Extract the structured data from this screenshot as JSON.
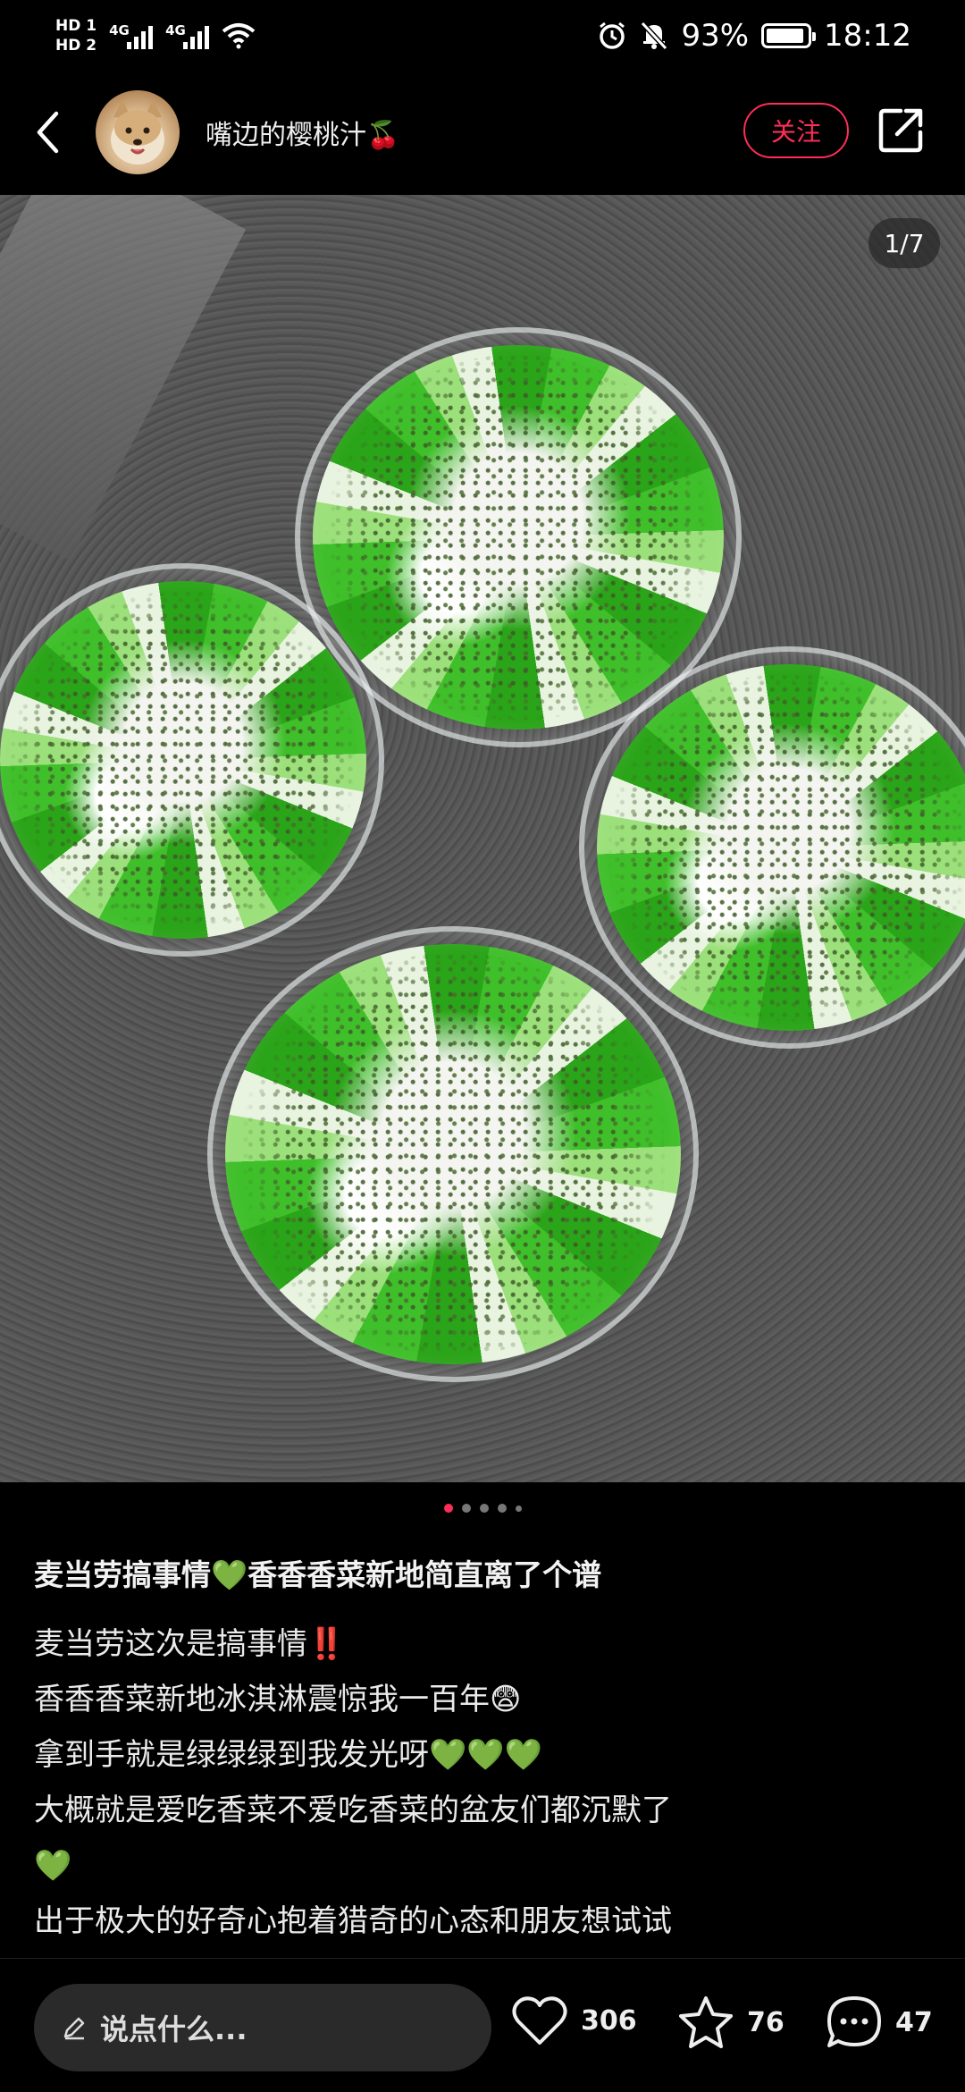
{
  "status_bar": {
    "sim1_label": "HD 1",
    "sim2_label": "HD 2",
    "network1": "4G",
    "network2": "4G",
    "battery_percent": "93%",
    "battery_level": 0.93,
    "time": "18:12",
    "icons": [
      "alarm-icon",
      "mute-icon",
      "wifi-icon",
      "battery-icon"
    ]
  },
  "header": {
    "username": "嘴边的樱桃汁🍒",
    "follow_label": "关注",
    "icons": [
      "back-icon",
      "share-icon"
    ]
  },
  "gallery": {
    "counter": "1/7",
    "current_index": 1,
    "total": 7
  },
  "post": {
    "title": "麦当劳搞事情💚香香香菜新地简直离了个谱",
    "lines": [
      "麦当劳这次是搞事情‼️",
      "香香香菜新地冰淇淋震惊我一百年😨",
      "拿到手就是绿绿绿到我发光呀💚💚💚",
      "大概就是爱吃香菜不爱吃香菜的盆友们都沉默了",
      "💚",
      "出于极大的好奇心抱着猎奇的心态和朋友想试试"
    ]
  },
  "bottom_bar": {
    "comment_placeholder": "说点什么...",
    "like_count": "306",
    "favorite_count": "76",
    "comment_count": "47",
    "accent_color": "#ff2e56"
  }
}
